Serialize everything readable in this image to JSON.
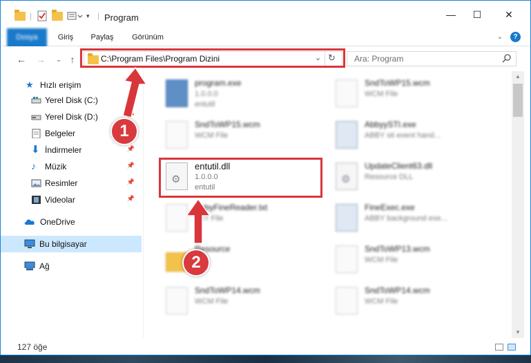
{
  "window": {
    "title": "Program",
    "controls": {
      "minimize": "—",
      "maximize": "☐",
      "close": "✕"
    }
  },
  "ribbon": {
    "tabs": [
      "Dosya",
      "Giriş",
      "Paylaş",
      "Görünüm"
    ],
    "help": "?"
  },
  "address": {
    "path": "C:\\Program Files\\Program Dizini",
    "search_placeholder": "Ara: Program"
  },
  "nav": {
    "items": [
      {
        "label": "Hızlı erişim",
        "icon": "star-icon",
        "pinned": false
      },
      {
        "label": "Yerel Disk (C:)",
        "icon": "drive-icon",
        "pinned": true
      },
      {
        "label": "Yerel Disk (D:)",
        "icon": "drive-icon",
        "pinned": true
      },
      {
        "label": "Belgeler",
        "icon": "documents-icon",
        "pinned": true
      },
      {
        "label": "İndirmeler",
        "icon": "download-icon",
        "pinned": true
      },
      {
        "label": "Müzik",
        "icon": "music-icon",
        "pinned": true
      },
      {
        "label": "Resimler",
        "icon": "pictures-icon",
        "pinned": true
      },
      {
        "label": "Videolar",
        "icon": "video-icon",
        "pinned": true
      },
      {
        "label": "OneDrive",
        "icon": "cloud-icon",
        "pinned": false
      },
      {
        "label": "Bu bilgisayar",
        "icon": "computer-icon",
        "pinned": false
      },
      {
        "label": "Ağ",
        "icon": "network-icon",
        "pinned": false
      }
    ]
  },
  "files": [
    {
      "name": "program.exe",
      "sub1": "1.0.0.0",
      "sub2": "entutil",
      "icon": "exe"
    },
    {
      "name": "SndToWP15.wcm",
      "sub1": "WCM File",
      "sub2": "",
      "icon": "doc"
    },
    {
      "name": "SndToWP15.wcm",
      "sub1": "WCM File",
      "sub2": "",
      "icon": "doc"
    },
    {
      "name": "AbbyySTI.exe",
      "sub1": "ABBY sti event hand...",
      "sub2": "",
      "icon": "win"
    },
    {
      "name": "entutil.dll",
      "sub1": "1.0.0.0",
      "sub2": "entutil",
      "icon": "dll"
    },
    {
      "name": "UpdateClient63.dll",
      "sub1": "Resource DLL",
      "sub2": "",
      "icon": "dll"
    },
    {
      "name": "AbbyFineReader.txt",
      "sub1": "TXT File",
      "sub2": "",
      "icon": "doc"
    },
    {
      "name": "FineExec.exe",
      "sub1": "ABBY background exe...",
      "sub2": "",
      "icon": "win"
    },
    {
      "name": "Resource",
      "sub1": "",
      "sub2": "",
      "icon": "fld"
    },
    {
      "name": "SndToWP13.wcm",
      "sub1": "WCM File",
      "sub2": "",
      "icon": "doc"
    },
    {
      "name": "SndToWP14.wcm",
      "sub1": "WCM File",
      "sub2": "",
      "icon": "doc"
    },
    {
      "name": "SndToWP14.wcm",
      "sub1": "WCM File",
      "sub2": "",
      "icon": "doc"
    }
  ],
  "status": {
    "count": "127 öğe"
  },
  "annotations": {
    "step1": "1",
    "step2": "2",
    "color": "#d9363b"
  }
}
